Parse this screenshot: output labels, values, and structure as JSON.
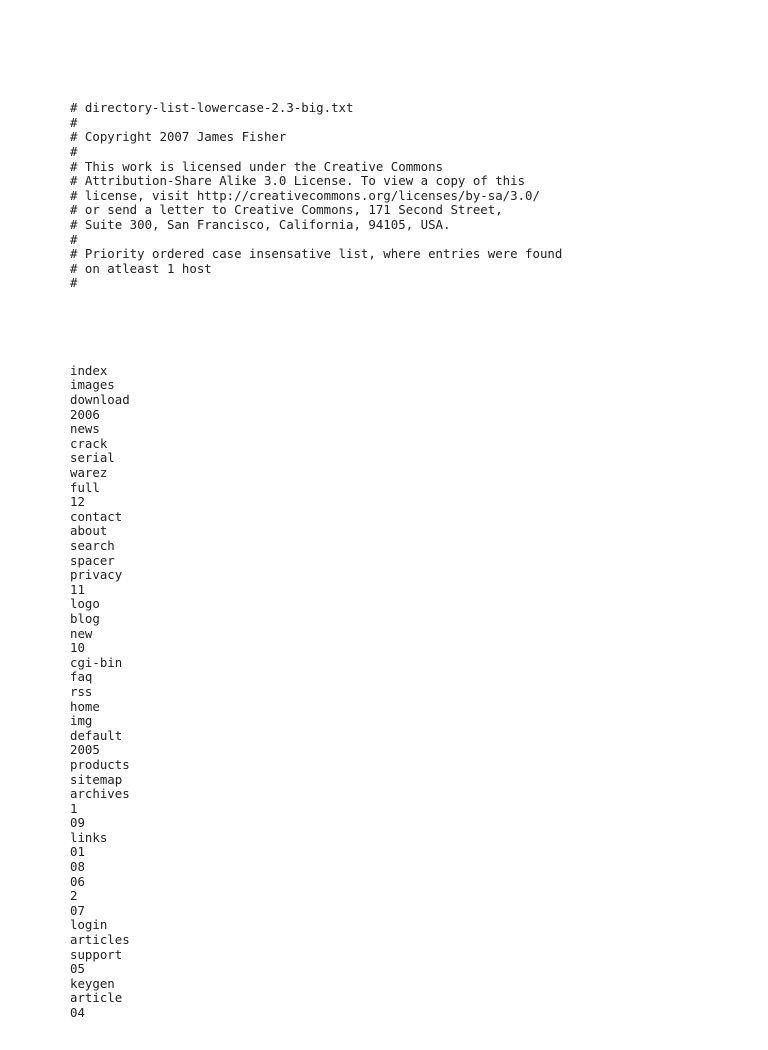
{
  "document": {
    "filename": "directory-list-lowercase-2.3-big.txt",
    "background_color": "#ffffff",
    "text_color": "#212121",
    "header_comments": [
      "# directory-list-lowercase-2.3-big.txt",
      "#",
      "# Copyright 2007 James Fisher",
      "#",
      "# This work is licensed under the Creative Commons",
      "# Attribution-Share Alike 3.0 License. To view a copy of this",
      "# license, visit http://creativecommons.org/licenses/by-sa/3.0/",
      "# or send a letter to Creative Commons, 171 Second Street,",
      "# Suite 300, San Francisco, California, 94105, USA.",
      "#",
      "# Priority ordered case insensative list, where entries were found",
      "# on atleast 1 host",
      "#"
    ],
    "entries": [
      "index",
      "images",
      "download",
      "2006",
      "news",
      "crack",
      "serial",
      "warez",
      "full",
      "12",
      "contact",
      "about",
      "search",
      "spacer",
      "privacy",
      "11",
      "logo",
      "blog",
      "new",
      "10",
      "cgi-bin",
      "faq",
      "rss",
      "home",
      "img",
      "default",
      "2005",
      "products",
      "sitemap",
      "archives",
      "1",
      "09",
      "links",
      "01",
      "08",
      "06",
      "2",
      "07",
      "login",
      "articles",
      "support",
      "05",
      "keygen",
      "article",
      "04"
    ]
  }
}
